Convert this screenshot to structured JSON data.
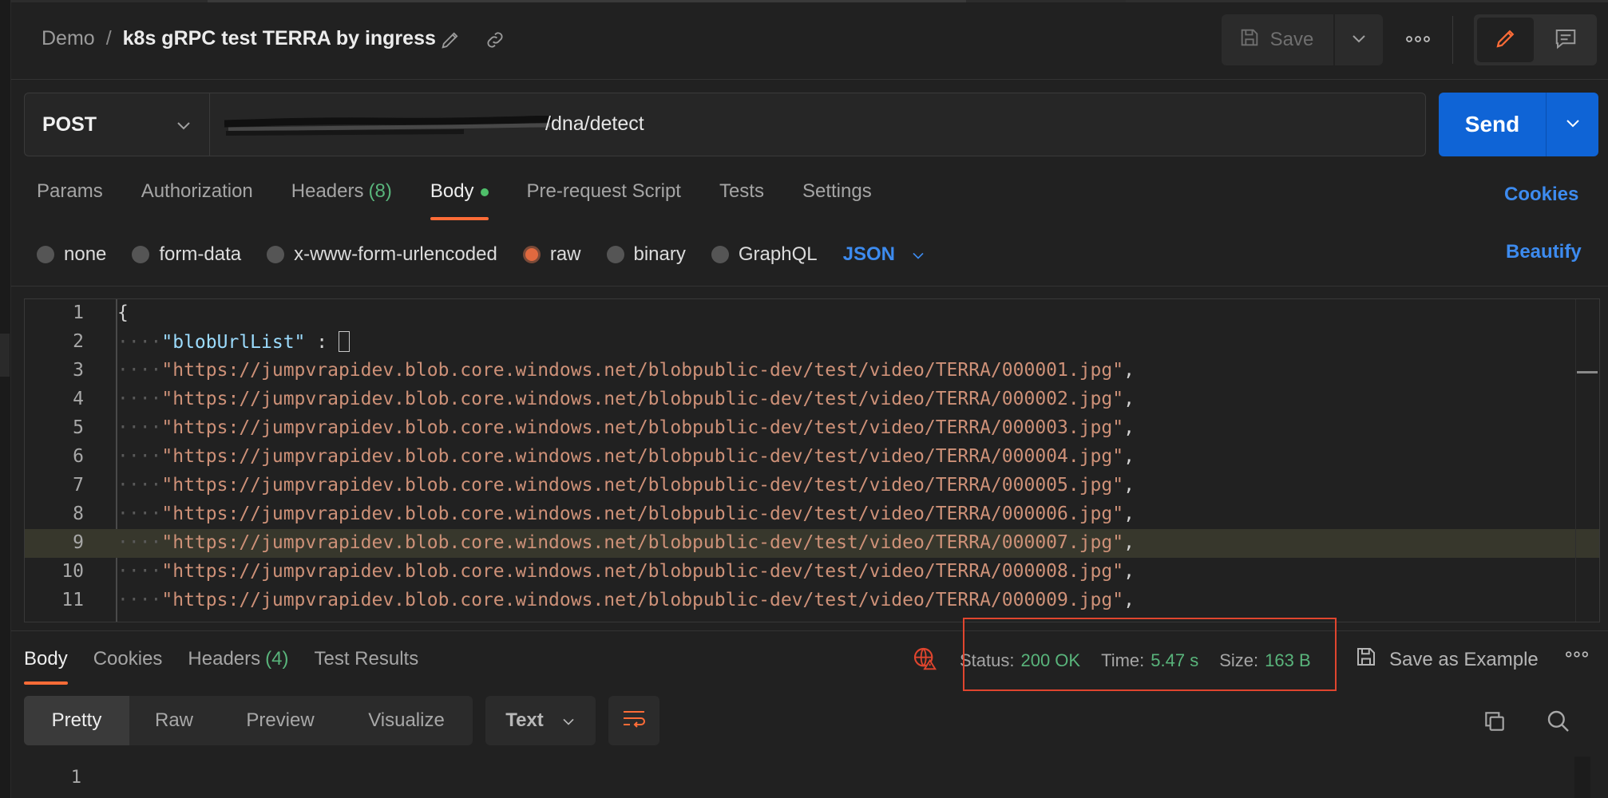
{
  "header": {
    "workspace": "Demo",
    "separator": "/",
    "request_name": "k8s gRPC test TERRA by ingress",
    "save_label": "Save"
  },
  "request": {
    "method": "POST",
    "url_visible": "/dna/detect",
    "send_label": "Send"
  },
  "request_tabs": [
    {
      "label": "Params"
    },
    {
      "label": "Authorization"
    },
    {
      "label": "Headers",
      "count": "(8)"
    },
    {
      "label": "Body"
    },
    {
      "label": "Pre-request Script"
    },
    {
      "label": "Tests"
    },
    {
      "label": "Settings"
    }
  ],
  "cookies_label": "Cookies",
  "body_types": [
    "none",
    "form-data",
    "x-www-form-urlencoded",
    "raw",
    "binary",
    "GraphQL"
  ],
  "selected_body_type": "raw",
  "format_label": "JSON",
  "beautify_label": "Beautify",
  "editor": {
    "line_numbers": [
      "1",
      "2",
      "3",
      "4",
      "5",
      "6",
      "7",
      "8",
      "9",
      "10",
      "11"
    ],
    "open_brace": "{",
    "key": "\"blobUrlList\"",
    "colon": " : ",
    "urls": [
      "\"https://jumpvrapidev.blob.core.windows.net/blobpublic-dev/test/video/TERRA/000001.jpg\"",
      "\"https://jumpvrapidev.blob.core.windows.net/blobpublic-dev/test/video/TERRA/000002.jpg\"",
      "\"https://jumpvrapidev.blob.core.windows.net/blobpublic-dev/test/video/TERRA/000003.jpg\"",
      "\"https://jumpvrapidev.blob.core.windows.net/blobpublic-dev/test/video/TERRA/000004.jpg\"",
      "\"https://jumpvrapidev.blob.core.windows.net/blobpublic-dev/test/video/TERRA/000005.jpg\"",
      "\"https://jumpvrapidev.blob.core.windows.net/blobpublic-dev/test/video/TERRA/000006.jpg\"",
      "\"https://jumpvrapidev.blob.core.windows.net/blobpublic-dev/test/video/TERRA/000007.jpg\"",
      "\"https://jumpvrapidev.blob.core.windows.net/blobpublic-dev/test/video/TERRA/000008.jpg\"",
      "\"https://jumpvrapidev.blob.core.windows.net/blobpublic-dev/test/video/TERRA/000009.jpg\""
    ],
    "comma": ","
  },
  "response": {
    "tabs": [
      {
        "label": "Body"
      },
      {
        "label": "Cookies"
      },
      {
        "label": "Headers",
        "count": "(4)"
      },
      {
        "label": "Test Results"
      }
    ],
    "status_label": "Status:",
    "status_value": "200 OK",
    "time_label": "Time:",
    "time_value": "5.47 s",
    "size_label": "Size:",
    "size_value": "163 B",
    "save_example_label": "Save as Example",
    "view_modes": [
      "Pretty",
      "Raw",
      "Preview",
      "Visualize"
    ],
    "format_label": "Text",
    "line_number": "1"
  },
  "colors": {
    "accent": "#ff6c37",
    "link": "#3d8bef",
    "send": "#0f64d6",
    "success": "#59b47b",
    "highlight_box": "#e0452e"
  }
}
